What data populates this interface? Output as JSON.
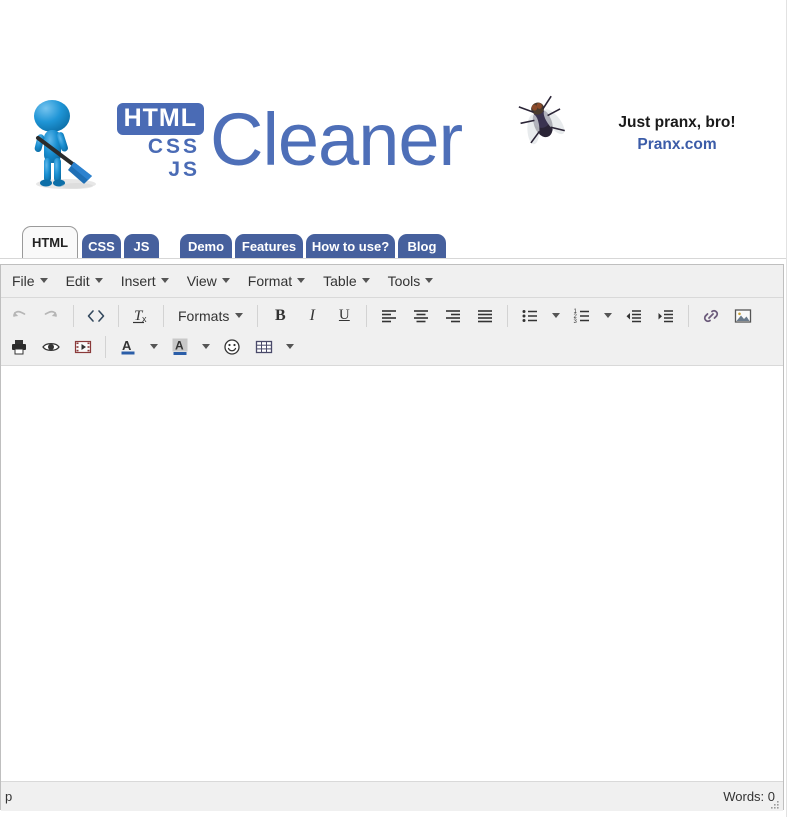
{
  "logo": {
    "html_badge": "HTML",
    "css_text": "CSS",
    "js_text": "JS",
    "wordmark": "Cleaner",
    "mascot_alt": "janitor-with-broom",
    "brand_blue": "#4a6bb5"
  },
  "ad": {
    "line1": "Just pranx, bro!",
    "line2": "Pranx.com",
    "image_alt": "fly",
    "line1_color": "#1a1a1a",
    "line2_color": "#3b5ca8"
  },
  "tabs": {
    "lang": [
      {
        "label": "HTML",
        "active": true
      },
      {
        "label": "CSS",
        "active": false
      },
      {
        "label": "JS",
        "active": false
      }
    ],
    "nav": [
      {
        "label": "Demo"
      },
      {
        "label": "Features"
      },
      {
        "label": "How to use?"
      },
      {
        "label": "Blog"
      }
    ],
    "active_color": "#f9f9f9",
    "inactive_color": "#46609d"
  },
  "menubar": [
    {
      "label": "File"
    },
    {
      "label": "Edit"
    },
    {
      "label": "Insert"
    },
    {
      "label": "View"
    },
    {
      "label": "Format"
    },
    {
      "label": "Table"
    },
    {
      "label": "Tools"
    }
  ],
  "toolbar_row1": [
    {
      "icon": "undo-icon",
      "label": "",
      "disabled": true
    },
    {
      "icon": "redo-icon",
      "label": "",
      "disabled": true
    },
    {
      "sep": true
    },
    {
      "icon": "source-code-icon",
      "label": ""
    },
    {
      "sep": true
    },
    {
      "icon": "clear-formatting-icon",
      "label": ""
    },
    {
      "sep": true
    },
    {
      "icon": "formats-dropdown",
      "label": "Formats"
    },
    {
      "sep": true
    },
    {
      "icon": "bold-icon",
      "label": ""
    },
    {
      "icon": "italic-icon",
      "label": ""
    },
    {
      "icon": "underline-icon",
      "label": ""
    },
    {
      "sep": true
    },
    {
      "icon": "align-left-icon",
      "label": ""
    },
    {
      "icon": "align-center-icon",
      "label": ""
    },
    {
      "icon": "align-right-icon",
      "label": ""
    },
    {
      "icon": "align-justify-icon",
      "label": ""
    },
    {
      "sep": true
    },
    {
      "icon": "bullet-list-icon",
      "label": ""
    },
    {
      "icon": "bullet-list-caret",
      "label": ""
    },
    {
      "icon": "numbered-list-icon",
      "label": ""
    },
    {
      "icon": "numbered-list-caret",
      "label": ""
    },
    {
      "icon": "outdent-icon",
      "label": ""
    },
    {
      "icon": "indent-icon",
      "label": ""
    },
    {
      "sep": true
    },
    {
      "icon": "link-icon",
      "label": ""
    },
    {
      "icon": "image-icon",
      "label": ""
    }
  ],
  "toolbar_row2": [
    {
      "icon": "print-icon",
      "label": ""
    },
    {
      "icon": "preview-icon",
      "label": ""
    },
    {
      "icon": "media-icon",
      "label": ""
    },
    {
      "sep": true
    },
    {
      "icon": "text-color-icon",
      "label": ""
    },
    {
      "icon": "text-color-caret",
      "label": ""
    },
    {
      "icon": "background-color-icon",
      "label": ""
    },
    {
      "icon": "background-color-caret",
      "label": ""
    },
    {
      "icon": "emoticon-icon",
      "label": ""
    },
    {
      "icon": "table-icon",
      "label": ""
    },
    {
      "icon": "table-caret",
      "label": ""
    }
  ],
  "labels": {
    "formats": "Formats"
  },
  "editor": {
    "body_text": "",
    "placeholder": ""
  },
  "statusbar": {
    "path": "p",
    "words": "Words: 0"
  }
}
